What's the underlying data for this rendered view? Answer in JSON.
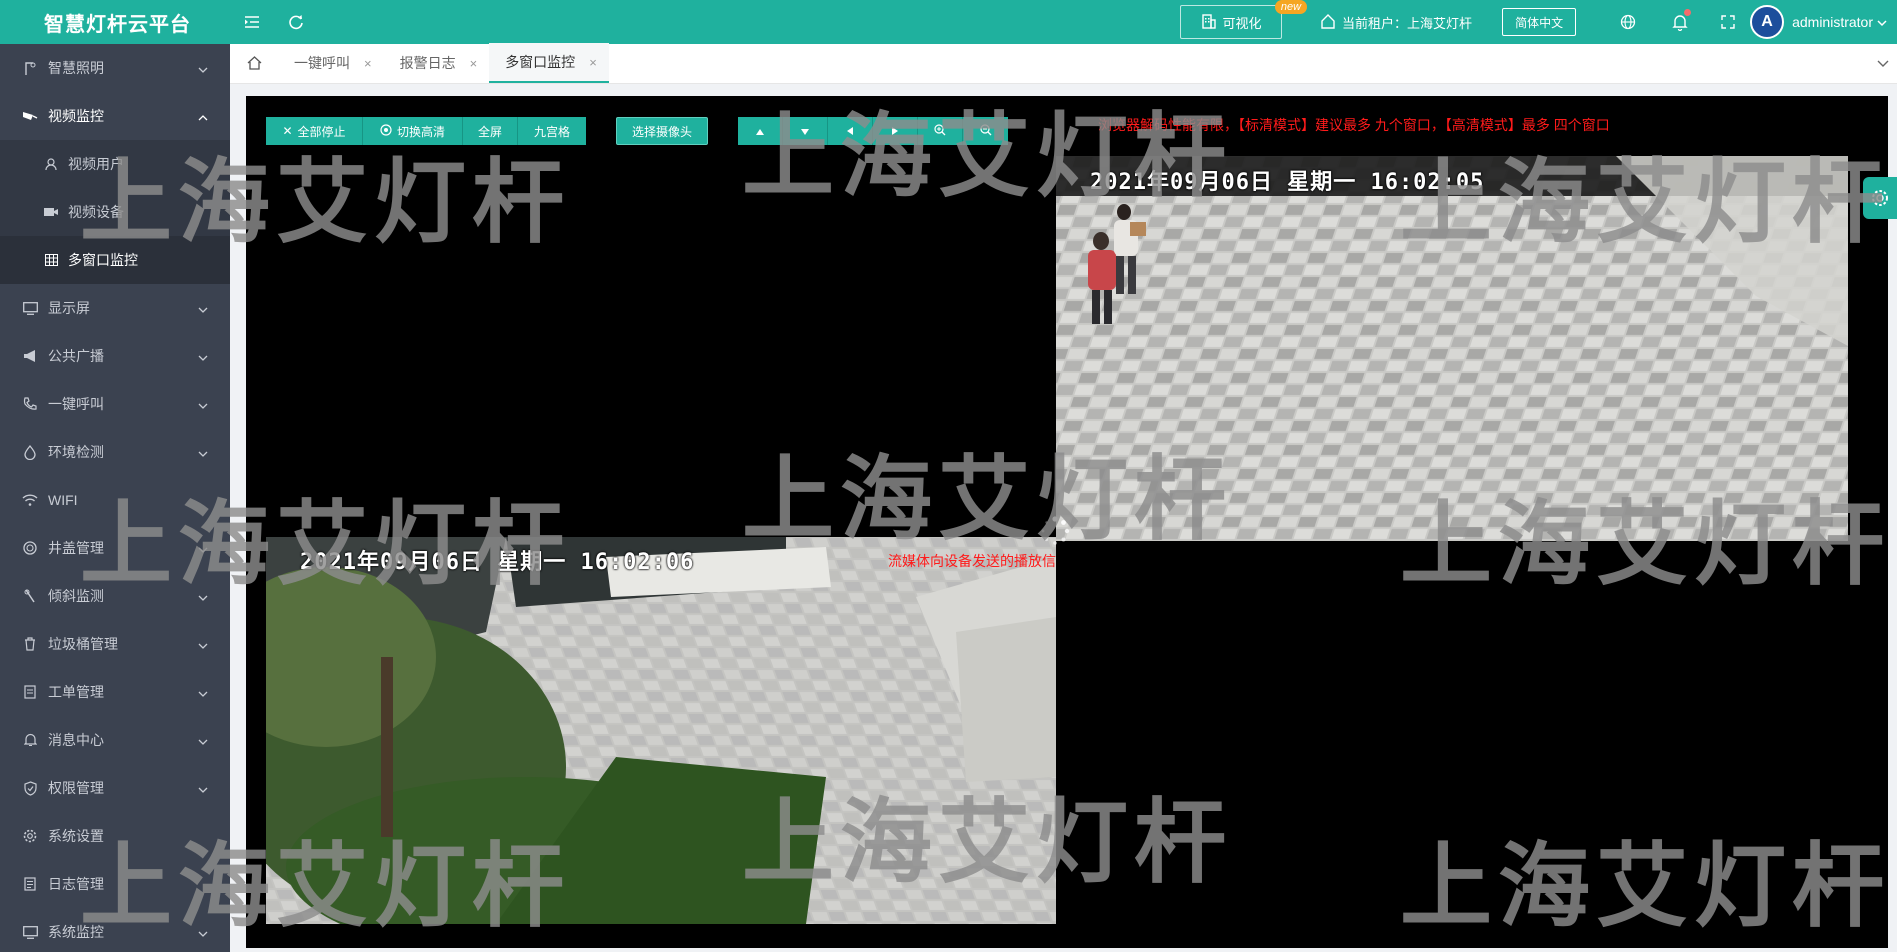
{
  "topbar": {
    "brand": "智慧灯杆云平台",
    "visual_label": "可视化",
    "new_badge": "new",
    "tenant_label": "当前租户：上海艾灯杆",
    "lang_label": "简体中文",
    "username": "administrator",
    "avatar_text": "A",
    "icons": [
      "menu-fold-icon",
      "refresh-icon",
      "building-icon",
      "home-icon",
      "globe-icon",
      "bell-icon",
      "fullscreen-icon",
      "chevron-down-icon"
    ]
  },
  "sidebar": {
    "items": [
      {
        "label": "智慧照明",
        "icon": "lamp-icon"
      },
      {
        "label": "视频监控",
        "icon": "camera-icon",
        "open": true,
        "children": [
          {
            "label": "视频用户",
            "icon": "user-icon"
          },
          {
            "label": "视频设备",
            "icon": "video-icon"
          },
          {
            "label": "多窗口监控",
            "icon": "grid-icon",
            "active": true
          }
        ]
      },
      {
        "label": "显示屏",
        "icon": "monitor-icon"
      },
      {
        "label": "公共广播",
        "icon": "megaphone-icon"
      },
      {
        "label": "一键呼叫",
        "icon": "phone-icon"
      },
      {
        "label": "环境检测",
        "icon": "drop-icon"
      },
      {
        "label": "WIFI",
        "icon": "wifi-icon"
      },
      {
        "label": "井盖管理",
        "icon": "manhole-icon"
      },
      {
        "label": "倾斜监测",
        "icon": "tilt-icon"
      },
      {
        "label": "垃圾桶管理",
        "icon": "trash-icon"
      },
      {
        "label": "工单管理",
        "icon": "order-icon"
      },
      {
        "label": "消息中心",
        "icon": "bell-icon"
      },
      {
        "label": "权限管理",
        "icon": "shield-icon"
      },
      {
        "label": "系统设置",
        "icon": "gear-icon"
      },
      {
        "label": "日志管理",
        "icon": "log-icon"
      },
      {
        "label": "系统监控",
        "icon": "monitor-icon"
      }
    ]
  },
  "tabs": {
    "items": [
      {
        "label": "一键呼叫"
      },
      {
        "label": "报警日志"
      },
      {
        "label": "多窗口监控",
        "active": true
      }
    ],
    "close_glyph": "×"
  },
  "toolbar": {
    "stop_all": "全部停止",
    "switch_hd": "切换高清",
    "fullscreen": "全屏",
    "nine_grid": "九宫格",
    "select_camera": "选择摄像头"
  },
  "notice": "浏览器解码性能有限，【标清模式】建议最多 九个窗口，【高清模式】最多 四个窗口",
  "cameras": {
    "top_right_osd": "2021年09月06日 星期一 16:02:05",
    "bottom_left_osd": "2021年09月06日 星期一 16:02:06",
    "bottom_left_error": "流媒体向设备发送的播放信令超时/cas响应超时"
  },
  "watermark": "上海艾灯杆",
  "colors": {
    "primary": "#1fb19e",
    "sidebar": "#3b4250",
    "error": "#ff1b1b"
  }
}
